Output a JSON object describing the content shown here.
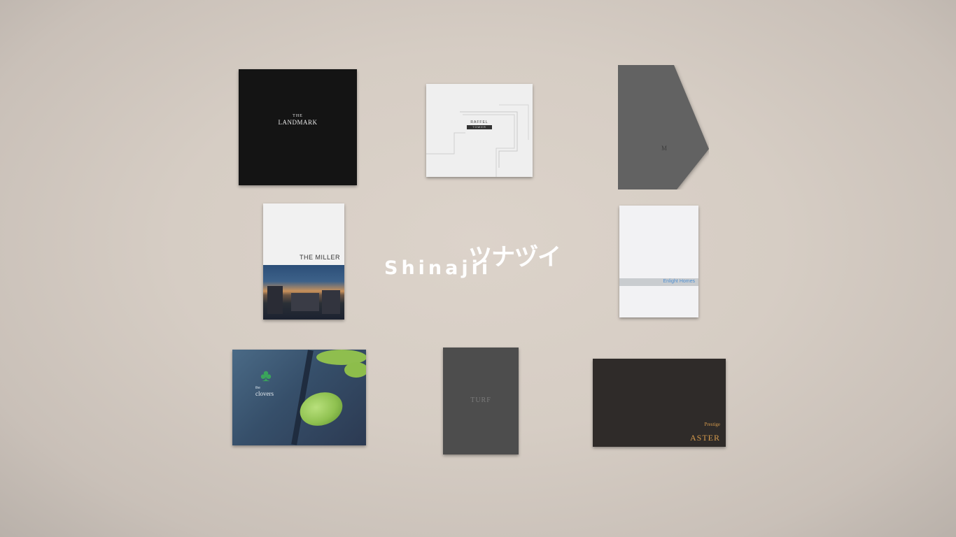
{
  "logo": {
    "japanese_text": "ツナヅイ",
    "english_text": "Shinajii"
  },
  "brochures": {
    "landmark": {
      "line1": "THE",
      "line2": "LANDMARK"
    },
    "raffel": {
      "line1": "RAFFEL",
      "line2": "TOWER"
    },
    "miller": {
      "title": "THE MILLER"
    },
    "enlight": {
      "title": "Enlight Homes"
    },
    "clovers": {
      "line1": "the",
      "line2": "clovers"
    },
    "turf": {
      "title": "TURF"
    },
    "aster": {
      "line1": "Prestige",
      "line2": "ASTER"
    }
  },
  "colors": {
    "background": "#d6cdc4",
    "logo": "#ffffff",
    "aster_gold": "#d59a4c",
    "enlight_blue": "#4f8fd1"
  }
}
